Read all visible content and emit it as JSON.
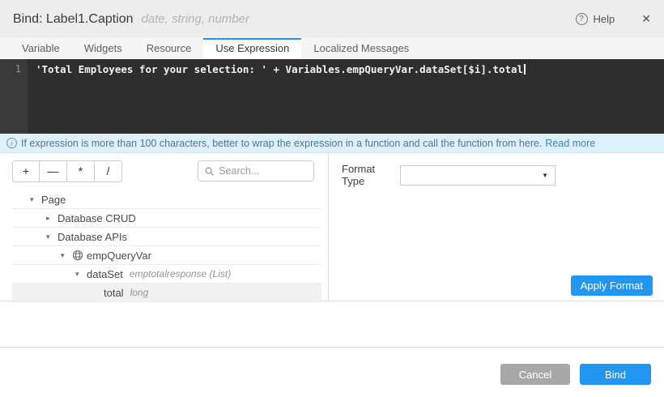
{
  "header": {
    "title": "Bind: Label1.Caption",
    "subtitle": "date, string, number",
    "help_label": "Help"
  },
  "tabs": [
    {
      "label": "Variable",
      "active": false
    },
    {
      "label": "Widgets",
      "active": false
    },
    {
      "label": "Resource",
      "active": false
    },
    {
      "label": "Use Expression",
      "active": true
    },
    {
      "label": "Localized Messages",
      "active": false
    }
  ],
  "editor": {
    "line_number": "1",
    "code": "'Total Employees for your selection: ' + Variables.empQueryVar.dataSet[$i].total"
  },
  "info_bar": {
    "text": "If expression is more than 100 characters, better to wrap the expression in a function and call the function from here.",
    "link_label": "Read more"
  },
  "toolbar": {
    "operators": [
      "+",
      "—",
      "*",
      "/"
    ]
  },
  "search": {
    "placeholder": "Search..."
  },
  "tree": {
    "items": [
      {
        "label": "Page",
        "type": "",
        "caret": "▾",
        "level": 0,
        "selected": false
      },
      {
        "label": "Database CRUD",
        "type": "",
        "caret": "▸",
        "level": 1,
        "selected": false
      },
      {
        "label": "Database APIs",
        "type": "",
        "caret": "▾",
        "level": 1,
        "selected": false
      },
      {
        "label": "empQueryVar",
        "type": "",
        "caret": "▾",
        "level": 2,
        "selected": false,
        "icon": "service-variable-icon"
      },
      {
        "label": "dataSet",
        "type": "emptotalresponse (List)",
        "caret": "▾",
        "level": 3,
        "selected": false
      },
      {
        "label": "total",
        "type": "long",
        "caret": "",
        "level": 4,
        "selected": true
      }
    ]
  },
  "format_panel": {
    "label": "Format Type",
    "dropdown_value": "",
    "apply_label": "Apply Format"
  },
  "footer": {
    "cancel_label": "Cancel",
    "bind_label": "Bind"
  },
  "icons": {
    "help": "?",
    "close": "✕",
    "info": "i",
    "dropdown_caret": "▼"
  },
  "colors": {
    "accent": "#2196f3",
    "cancel_button": "#a8a8a8",
    "info_bar_bg": "#def0fa",
    "editor_bg": "#2e2e2e"
  }
}
